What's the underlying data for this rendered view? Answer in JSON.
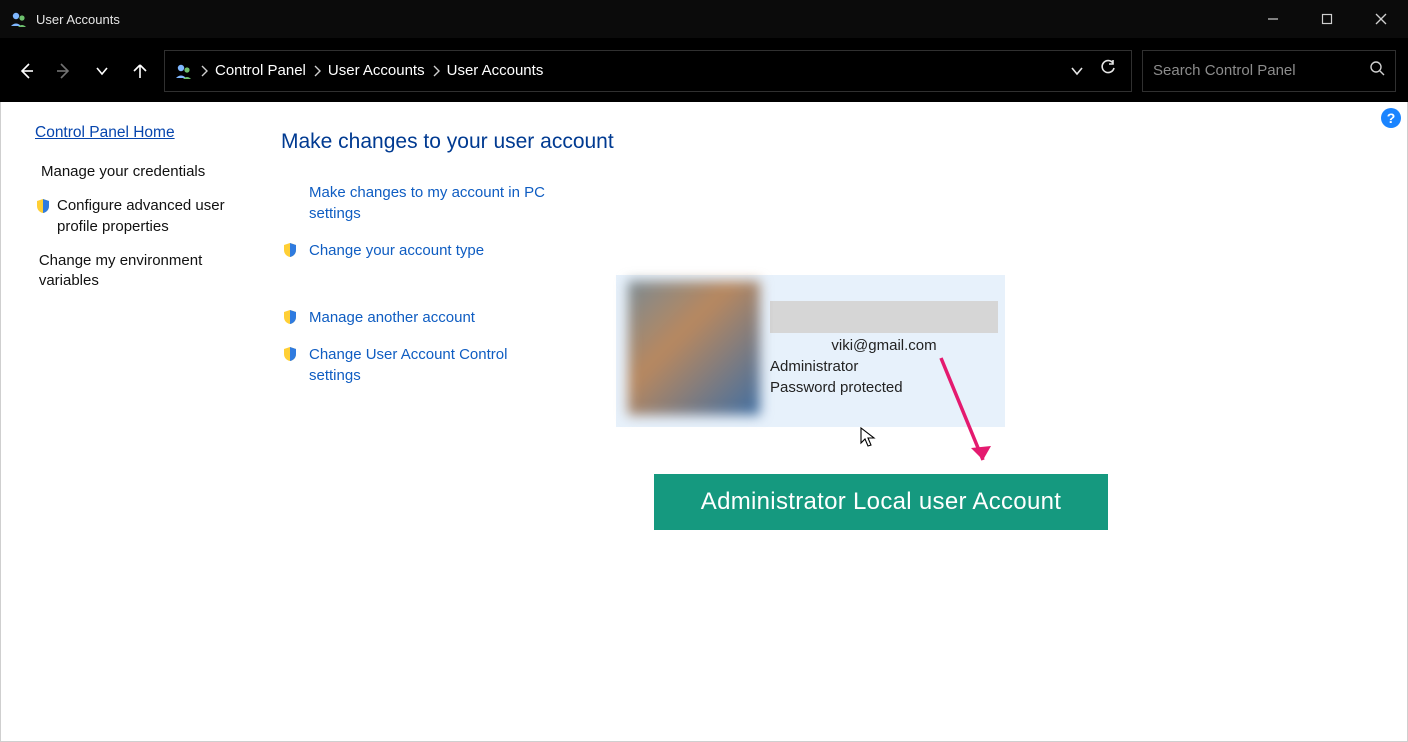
{
  "window": {
    "title": "User Accounts"
  },
  "breadcrumbs": {
    "c0": "Control Panel",
    "c1": "User Accounts",
    "c2": "User Accounts"
  },
  "search": {
    "placeholder": "Search Control Panel"
  },
  "sidebar": {
    "home": "Control Panel Home",
    "i0": "Manage your credentials",
    "i1": "Configure advanced user profile properties",
    "i2": "Change my environment variables"
  },
  "main": {
    "heading": "Make changes to your user account",
    "l0": "Make changes to my account in PC settings",
    "l1": "Change your account type",
    "l2": "Manage another account",
    "l3": "Change User Account Control settings"
  },
  "account": {
    "email": "viki@gmail.com",
    "role": "Administrator",
    "protection": "Password protected"
  },
  "annotation": {
    "label": "Administrator Local user Account"
  },
  "help": {
    "symbol": "?"
  }
}
